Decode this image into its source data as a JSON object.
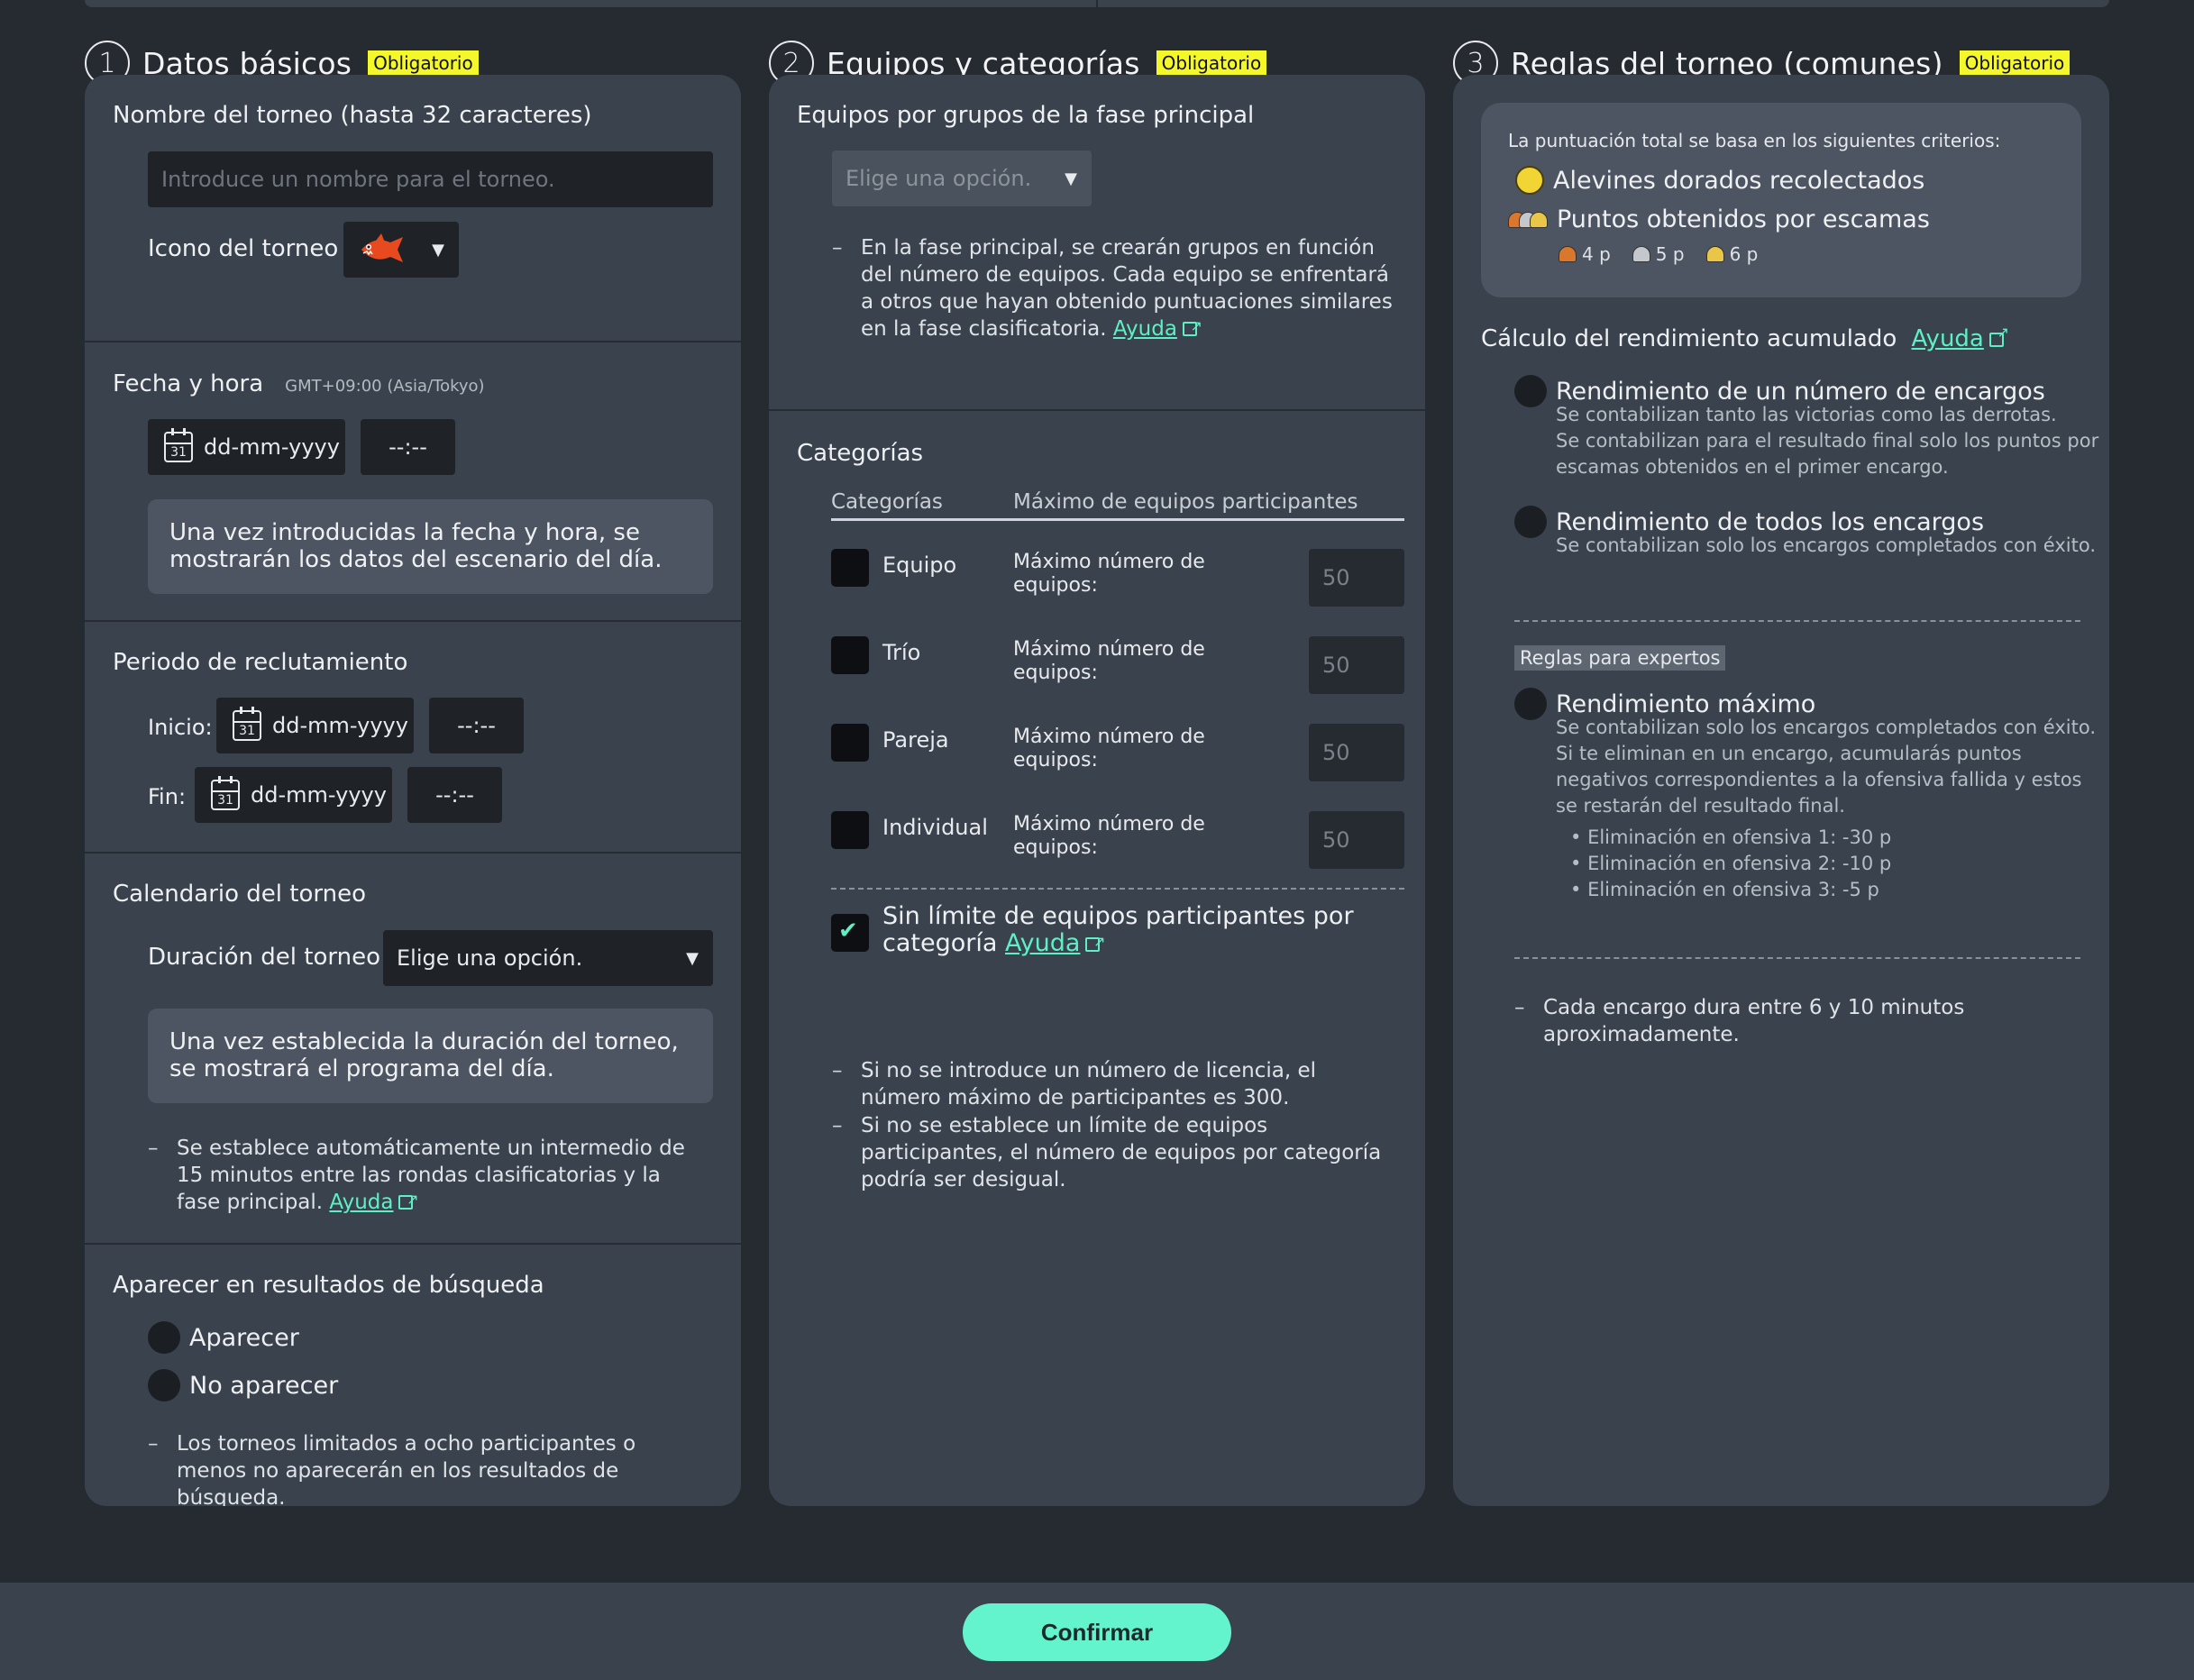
{
  "required_badge": "Obligatorio",
  "colors": {
    "accent": "#63f4cd",
    "badge": "#f4f72a",
    "panel": "#39424d",
    "background": "#262a31"
  },
  "col1": {
    "number": "1",
    "title": "Datos básicos",
    "name_label": "Nombre del torneo (hasta 32 caracteres)",
    "name_placeholder": "Introduce un nombre para el torneo.",
    "icon_label": "Icono del torneo",
    "icon_name": "fish-icon",
    "datetime_label": "Fecha y hora",
    "timezone": "GMT+09:00 (Asia/Tokyo)",
    "date_placeholder": "dd-mm-yyyy",
    "time_placeholder": "--:--",
    "datetime_note": "Una vez introducidas la fecha y hora, se mostrarán los datos del escenario del día.",
    "recruit_label": "Periodo de reclutamiento",
    "start_label": "Inicio:",
    "end_label": "Fin:",
    "calendar_day": "31",
    "schedule_label": "Calendario del torneo",
    "duration_label": "Duración del torneo",
    "duration_select": "Elige una opción.",
    "schedule_note": "Una vez establecida la duración del torneo, se mostrará el programa del día.",
    "intermission_note": "Se establece automáticamente un intermedio de 15 minutos entre las rondas clasificatorias y la fase principal.",
    "help": "Ayuda",
    "search_label": "Aparecer en resultados de búsqueda",
    "appear": "Aparecer",
    "not_appear": "No aparecer",
    "search_note": "Los torneos limitados a ocho participantes o menos no aparecerán en los resultados de búsqueda."
  },
  "col2": {
    "number": "2",
    "title": "Equipos y categorías",
    "groups_label": "Equipos por grupos de la fase principal",
    "groups_select": "Elige una opción.",
    "groups_note": "En la fase principal, se crearán grupos en función del número de equipos. Cada equipo se enfrentará a otros que hayan obtenido puntuaciones similares en la fase clasificatoria.",
    "help": "Ayuda",
    "categories_label": "Categorías",
    "table_head_cat": "Categorías",
    "table_head_max": "Máximo de equipos participantes",
    "max_label": "Máximo número de equipos:",
    "rows": [
      {
        "name": "Equipo",
        "value": "50"
      },
      {
        "name": "Trío",
        "value": "50"
      },
      {
        "name": "Pareja",
        "value": "50"
      },
      {
        "name": "Individual",
        "value": "50"
      }
    ],
    "no_limit_label": "Sin límite de equipos participantes por categoría",
    "note1": "Si no se introduce un número de licencia, el número máximo de participantes es 300.",
    "note2": "Si no se establece un límite de equipos participantes, el número de equipos por categoría podría ser desigual."
  },
  "col3": {
    "number": "3",
    "title": "Reglas del torneo (comunes)",
    "score_intro": "La puntuación total se basa en los siguientes criterios:",
    "crit1": "Alevines dorados recolectados",
    "crit2": "Puntos obtenidos por escamas",
    "scale_points": [
      "4 p",
      "5 p",
      "6 p"
    ],
    "perf_label": "Cálculo del rendimiento acumulado",
    "help": "Ayuda",
    "opt1_title": "Rendimiento de un número de encargos",
    "opt1_desc": [
      "Se contabilizan tanto las victorias como las derrotas.",
      "Se contabilizan para el resultado final solo los puntos por",
      "escamas obtenidos en el primer encargo."
    ],
    "opt2_title": "Rendimiento de todos los encargos",
    "opt2_desc": "Se contabilizan solo los encargos completados con éxito.",
    "expert_label": "Reglas para expertos",
    "opt3_title": "Rendimiento máximo",
    "opt3_desc": [
      "Se contabilizan solo los encargos completados con éxito.",
      "Si te eliminan en un encargo, acumularás puntos",
      "negativos correspondientes a la ofensiva fallida y estos",
      "se restarán del resultado final."
    ],
    "eliminations": [
      "Eliminación en ofensiva 1: -30 p",
      "Eliminación en ofensiva 2: -10 p",
      "Eliminación en ofensiva 3:   -5 p"
    ],
    "duration_note": "Cada encargo dura entre 6 y 10 minutos aproximadamente."
  },
  "confirm_label": "Confirmar"
}
